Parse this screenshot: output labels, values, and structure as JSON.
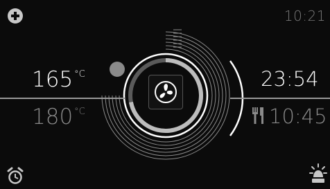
{
  "header": {
    "clock": "10:21"
  },
  "temperature": {
    "current": "165",
    "current_unit": "°C",
    "target": "180",
    "target_unit": "°C"
  },
  "timer": {
    "cook_time": "23:54",
    "end_time": "10:45"
  },
  "progress": {
    "cook_fraction": 0.72
  },
  "icons": {
    "add": "plus-circle-icon",
    "fan": "fan-icon",
    "fork_knife": "fork-knife-icon",
    "alarm": "alarm-clock-icon",
    "light": "light-bulb-icon"
  },
  "colors": {
    "background": "#0b0b0b",
    "accent": "#ffffff",
    "muted": "#8a8a8a"
  }
}
